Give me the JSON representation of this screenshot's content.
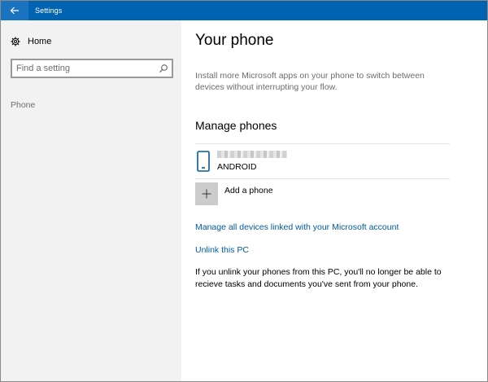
{
  "window": {
    "title": "Settings"
  },
  "sidebar": {
    "home_label": "Home",
    "search_placeholder": "Find a setting",
    "category_label": "Phone"
  },
  "main": {
    "title": "Your phone",
    "intro": "Install more Microsoft apps on your phone to switch between devices without interrupting your flow.",
    "manage_heading": "Manage phones",
    "device": {
      "type": "ANDROID"
    },
    "add_phone_label": "Add a phone",
    "manage_devices_link": "Manage all devices linked with your Microsoft account",
    "unlink_link": "Unlink this PC",
    "unlink_note": "If you unlink your phones from this PC, you'll no longer be able to recieve tasks and documents you've sent from your phone."
  },
  "colors": {
    "titlebar": "#0063b1",
    "sidebar_bg": "#f2f2f2",
    "link": "#005a9e",
    "muted_text": "#6d6d6d",
    "add_tile": "#cccccc"
  },
  "icons": {
    "back": "back-arrow-icon",
    "home": "gear-icon",
    "search": "search-icon",
    "device": "phone-icon",
    "add": "plus-icon"
  }
}
